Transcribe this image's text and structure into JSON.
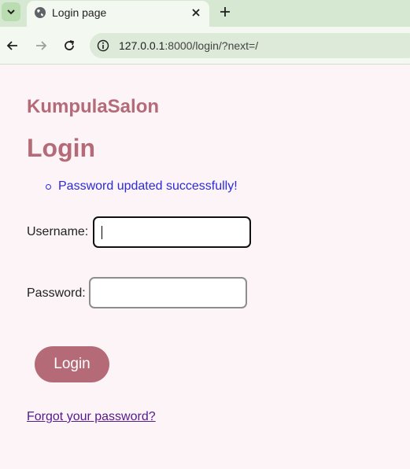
{
  "browser": {
    "tab_title": "Login page",
    "url_host": "127.0.0.1",
    "url_rest": ":8000/login/?next=/"
  },
  "page": {
    "brand": "KumpulaSalon",
    "title": "Login",
    "messages": [
      "Password updated successfully!"
    ],
    "form": {
      "username_label": "Username:",
      "username_value": "",
      "password_label": "Password:",
      "password_value": "",
      "submit_label": "Login"
    },
    "forgot_link": "Forgot your password?"
  },
  "colors": {
    "brand": "#b56b77",
    "message": "#2b2bdb",
    "background": "#fcf4f6"
  }
}
